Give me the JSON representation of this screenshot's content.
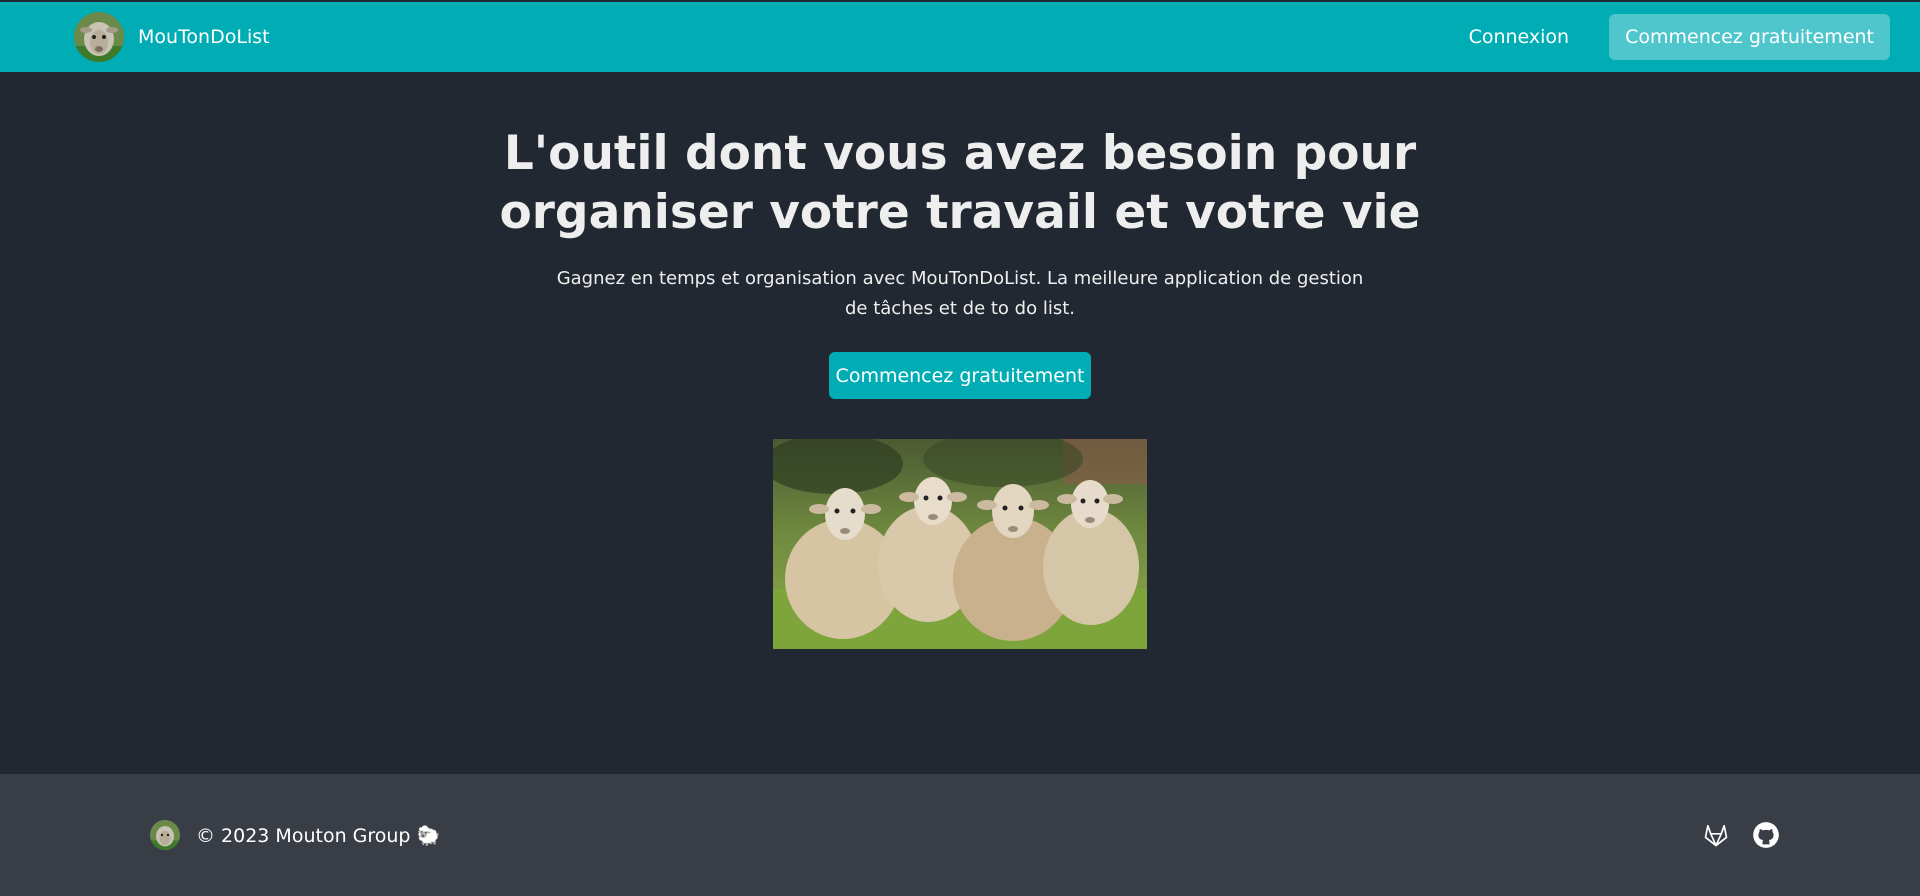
{
  "navbar": {
    "brand_name": "MouTonDoList",
    "login_label": "Connexion",
    "cta_label": "Commencez gratuitement"
  },
  "hero": {
    "title": "L'outil dont vous avez besoin pour organiser votre travail et votre vie",
    "subtitle": "Gagnez en temps et organisation avec MouTonDoList. La meilleure application de gestion de tâches et de to do list.",
    "cta_label": "Commencez gratuitement"
  },
  "footer": {
    "copyright": "© 2023 Mouton Group 🐑",
    "icons": [
      "gitlab-icon",
      "github-icon"
    ]
  },
  "colors": {
    "navbar_bg": "#00adb5",
    "nav_cta_bg": "#4fc6cc",
    "page_bg": "#222831",
    "footer_bg": "#393e46",
    "text": "#eeeeee"
  }
}
